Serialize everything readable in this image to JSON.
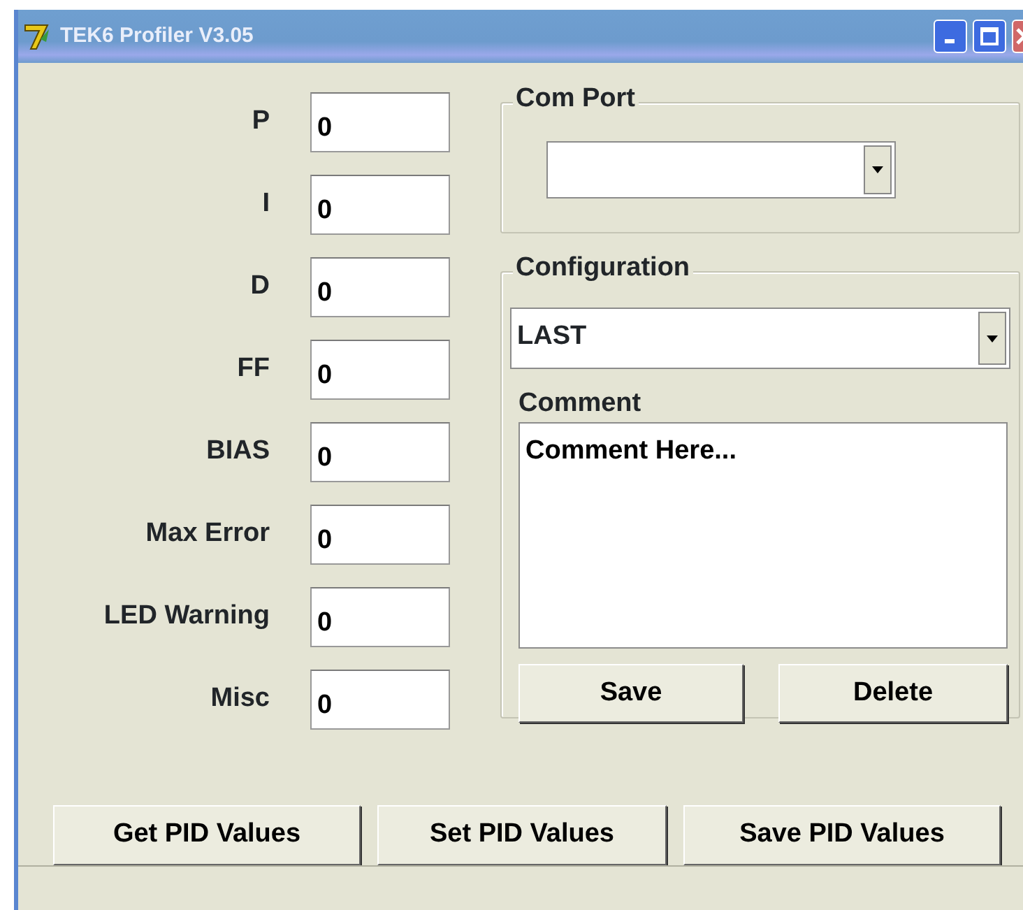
{
  "window": {
    "title": "TEK6 Profiler V3.05"
  },
  "parameters": [
    {
      "label": "P",
      "value": "0"
    },
    {
      "label": "I",
      "value": "0"
    },
    {
      "label": "D",
      "value": "0"
    },
    {
      "label": "FF",
      "value": "0"
    },
    {
      "label": "BIAS",
      "value": "0"
    },
    {
      "label": "Max Error",
      "value": "0"
    },
    {
      "label": "LED Warning",
      "value": "0"
    },
    {
      "label": "Misc",
      "value": "0"
    }
  ],
  "com_port": {
    "title": "Com Port"
  },
  "configuration": {
    "title": "Configuration",
    "value": "LAST",
    "comment_label": "Comment",
    "comment": "Comment Here...",
    "buttons": [
      "Save",
      "Delete"
    ]
  },
  "buttons": [
    "Get PID Values",
    "Set PID Values",
    "Save PID Values"
  ]
}
